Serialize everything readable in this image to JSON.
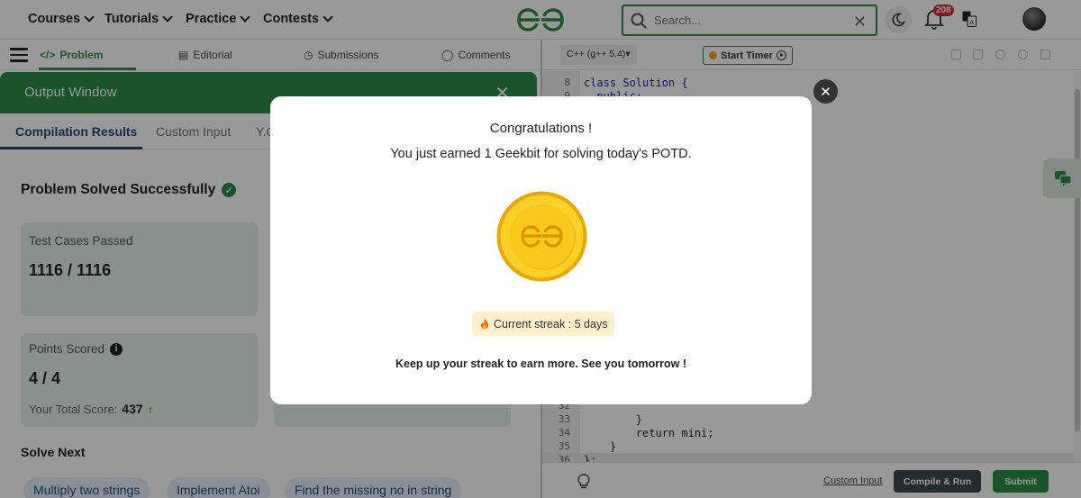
{
  "nav": {
    "items": [
      "Courses",
      "Tutorials",
      "Practice",
      "Contests"
    ],
    "search_placeholder": "Search...",
    "notification_count": "208"
  },
  "problem_tabs": [
    "Problem",
    "Editorial",
    "Submissions",
    "Comments"
  ],
  "output_window": {
    "title": "Output Window",
    "tabs": [
      "Compilation Results",
      "Custom Input",
      "Y.O"
    ],
    "status": "Problem Solved Successfully",
    "test_cases_label": "Test Cases Passed",
    "test_cases_value": "1116 / 1116",
    "points_label": "Points Scored",
    "points_value": "4 / 4",
    "total_score_label": "Your Total Score:",
    "total_score_value": "437",
    "solve_next_label": "Solve Next",
    "solve_next": [
      "Multiply two strings",
      "Implement Atoi",
      "Find the missing no in string"
    ]
  },
  "editor": {
    "language": "C++ (g++ 5.4)",
    "timer_label": "Start Timer",
    "code_lines": [
      {
        "n": "8",
        "text": "class Solution {"
      },
      {
        "n": "9",
        "text": "  public:"
      },
      {
        "n": "32",
        "text": ""
      },
      {
        "n": "33",
        "text": "        }"
      },
      {
        "n": "34",
        "text": "        return mini;"
      },
      {
        "n": "35",
        "text": "    }"
      },
      {
        "n": "36",
        "text": "};"
      }
    ],
    "custom_input_link": "Custom Input",
    "compile_run": "Compile & Run",
    "submit": "Submit"
  },
  "modal": {
    "title": "Congratulations !",
    "subtitle": "You just earned 1 Geekbit for solving today's POTD.",
    "streak": "Current streak : 5 days",
    "footer": "Keep up your streak to earn more. See you tomorrow !"
  },
  "colors": {
    "brand_green": "#2f8d46",
    "navy": "#1e4d7a",
    "coin_gold": "#f5c518",
    "streak_bg": "#fdf0cc"
  }
}
